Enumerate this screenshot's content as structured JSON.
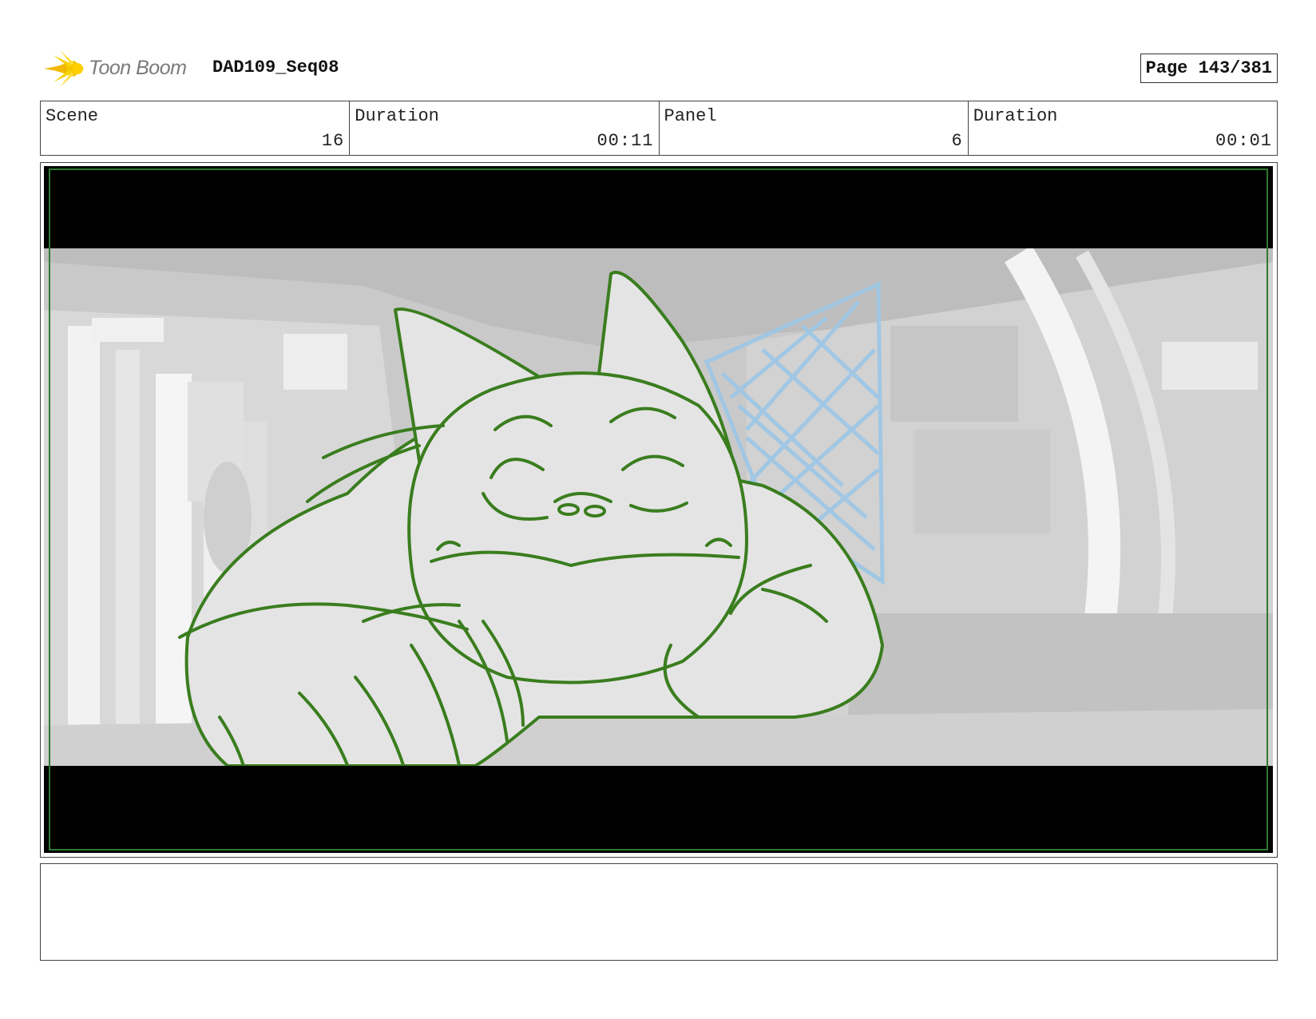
{
  "header": {
    "logo_text": "Toon Boom",
    "project": "DAD109_Seq08",
    "page": "Page 143/381"
  },
  "info": {
    "scene_label": "Scene",
    "scene_value": "16",
    "scene_duration_label": "Duration",
    "scene_duration_value": "00:11",
    "panel_label": "Panel",
    "panel_value": "6",
    "panel_duration_label": "Duration",
    "panel_duration_value": "00:01"
  },
  "notes": {
    "text": ""
  },
  "colors": {
    "sketch_green": "#3a7d1e",
    "net_blue": "#9cc6e6",
    "logo_yellow": "#f5c400",
    "safe_frame": "#2f7a2f"
  }
}
